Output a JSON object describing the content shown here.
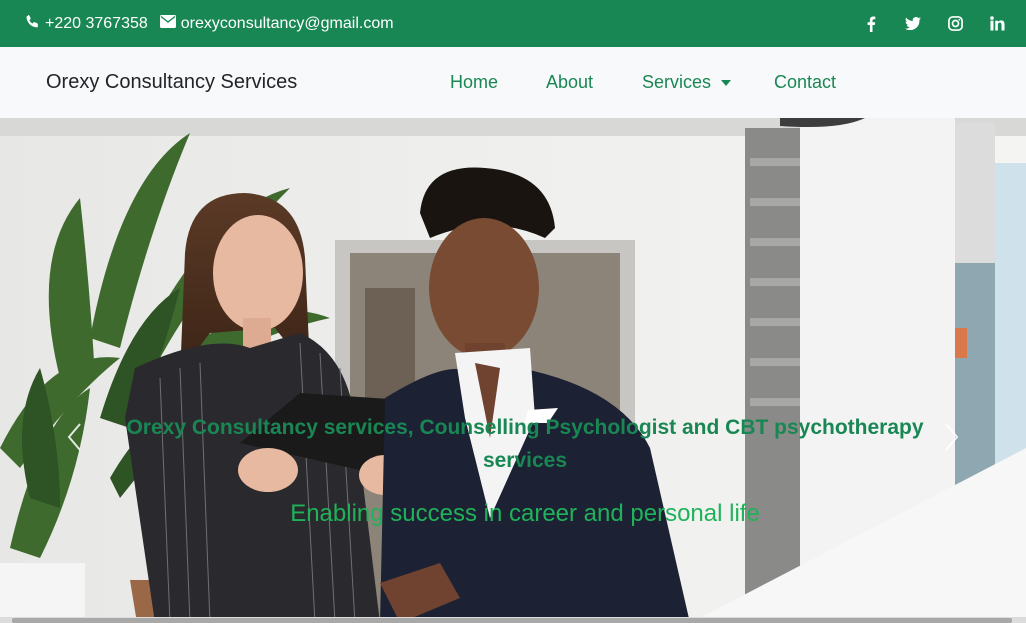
{
  "topbar": {
    "phone": "+220 3767358",
    "email": "orexyconsultancy@gmail.com",
    "icons": [
      "phone-icon",
      "envelope-icon",
      "facebook-icon",
      "twitter-icon",
      "instagram-icon",
      "linkedin-icon"
    ],
    "bg_color": "#198754"
  },
  "navbar": {
    "brand": "Orexy Consultancy Services",
    "items": [
      {
        "label": "Home"
      },
      {
        "label": "About"
      },
      {
        "label": "Services"
      },
      {
        "label": "Contact"
      }
    ],
    "link_color": "#198754"
  },
  "hero": {
    "title": "Orexy Consultancy services, Counselling Psychologist and CBT psychotherapy services",
    "subtitle": "Enabling success in career and personal life",
    "prev_icon": "chevron-left-icon",
    "next_icon": "chevron-right-icon"
  }
}
